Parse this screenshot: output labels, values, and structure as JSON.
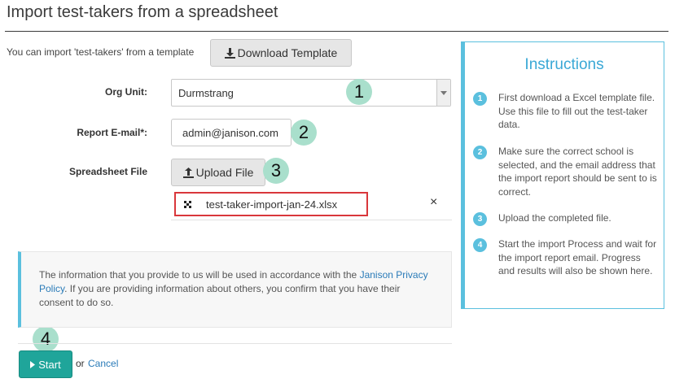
{
  "page": {
    "title": "Import test-takers from a spreadsheet"
  },
  "template": {
    "intro": "You can import 'test-takers' from a template",
    "download_label": "Download Template"
  },
  "form": {
    "org_unit": {
      "label": "Org Unit:",
      "value": "Durmstrang"
    },
    "report_email": {
      "label": "Report E-mail*:",
      "value": "admin@janison.com"
    },
    "spreadsheet": {
      "label": "Spreadsheet File",
      "upload_label": "Upload File",
      "file_name": "test-taker-import-jan-24.xlsx",
      "remove_symbol": "×"
    }
  },
  "annotations": [
    "1",
    "2",
    "3",
    "4"
  ],
  "notice": {
    "part1": "The information that you provide to us will be used in accordance with the ",
    "link": "Janison Privacy Policy",
    "part2": ". If you are providing information about others, you confirm that you have their consent to do so."
  },
  "actions": {
    "start_label": "Start",
    "or_text": "or",
    "cancel_label": "Cancel"
  },
  "instructions": {
    "title": "Instructions",
    "steps": [
      {
        "num": "1",
        "text": "First download a Excel template file. Use this file to fill out the test-taker data."
      },
      {
        "num": "2",
        "text": "Make sure the correct school is selected, and the email address that the import report should be sent to is correct."
      },
      {
        "num": "3",
        "text": "Upload the completed file."
      },
      {
        "num": "4",
        "text": "Start the import Process and wait for the import report email. Progress and results will also be shown here."
      }
    ]
  },
  "colors": {
    "accent": "#5bc0de",
    "start_button": "#1fa59a",
    "badge": "#a9dfcc",
    "highlight_border": "#d9373b",
    "link": "#2a7bb8"
  },
  "icons": {
    "download": "download-icon",
    "upload": "upload-icon",
    "dropdown": "caret-down-icon",
    "file": "file-grid-icon",
    "start": "play-icon"
  }
}
